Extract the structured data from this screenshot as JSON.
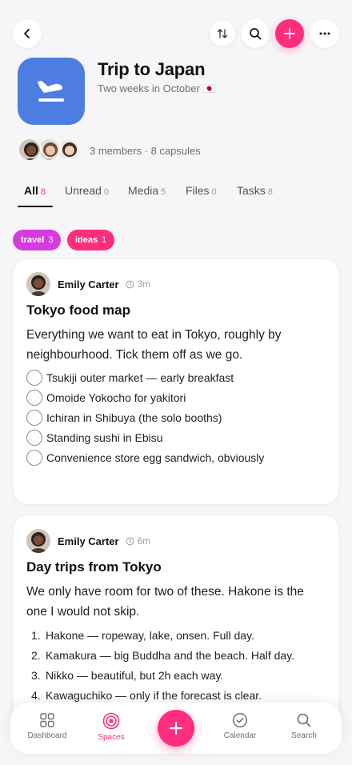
{
  "header": {
    "title": "Trip to Japan",
    "subtitle": "Two weeks in October 🇯🇵",
    "meta": "3 members · 8 capsules",
    "accent": "#ff2d7e",
    "space_icon": "airplane-landing-icon",
    "space_icon_color": "#4d7de0"
  },
  "toolbar": {
    "back": "chevron-left-icon",
    "sort": "sort-icon",
    "search": "search-icon",
    "add": "plus-icon",
    "more": "more-icon"
  },
  "tabs": [
    {
      "label": "All",
      "count": "8"
    },
    {
      "label": "Unread",
      "count": "0"
    },
    {
      "label": "Media",
      "count": "5"
    },
    {
      "label": "Files",
      "count": "0"
    },
    {
      "label": "Tasks",
      "count": "8"
    }
  ],
  "chips": [
    {
      "label": "travel",
      "count": "3",
      "color": "#d63be0"
    },
    {
      "label": "ideas",
      "count": "1",
      "color": "#ff2d7e"
    }
  ],
  "capsules": [
    {
      "author": "Emily Carter",
      "time": "3m",
      "title": "Tokyo food map",
      "body": "Everything we want to eat in Tokyo, roughly by neighbourhood. Tick them off as we go.",
      "items": [
        "Tsukiji outer market — early breakfast",
        "Omoide Yokocho for yakitori",
        "Ichiran in Shibuya (the solo booths)",
        "Standing sushi in Ebisu",
        "Convenience store egg sandwich, obviously"
      ]
    },
    {
      "author": "Emily Carter",
      "time": "6m",
      "title": "Day trips from Tokyo",
      "body": "We only have room for two of these. Hakone is the one I would not skip.",
      "items": [
        "Hakone — ropeway, lake, onsen. Full day.",
        "Kamakura — big Buddha and the beach. Half day.",
        "Nikko — beautiful, but 2h each way.",
        "Kawaguchiko — only if the forecast is clear."
      ]
    }
  ],
  "nav": [
    {
      "label": "Dashboard",
      "icon": "grid-icon"
    },
    {
      "label": "Spaces",
      "icon": "spaces-icon"
    },
    {
      "label": "Calendar",
      "icon": "check-circle-icon"
    },
    {
      "label": "Search",
      "icon": "search-icon"
    }
  ]
}
